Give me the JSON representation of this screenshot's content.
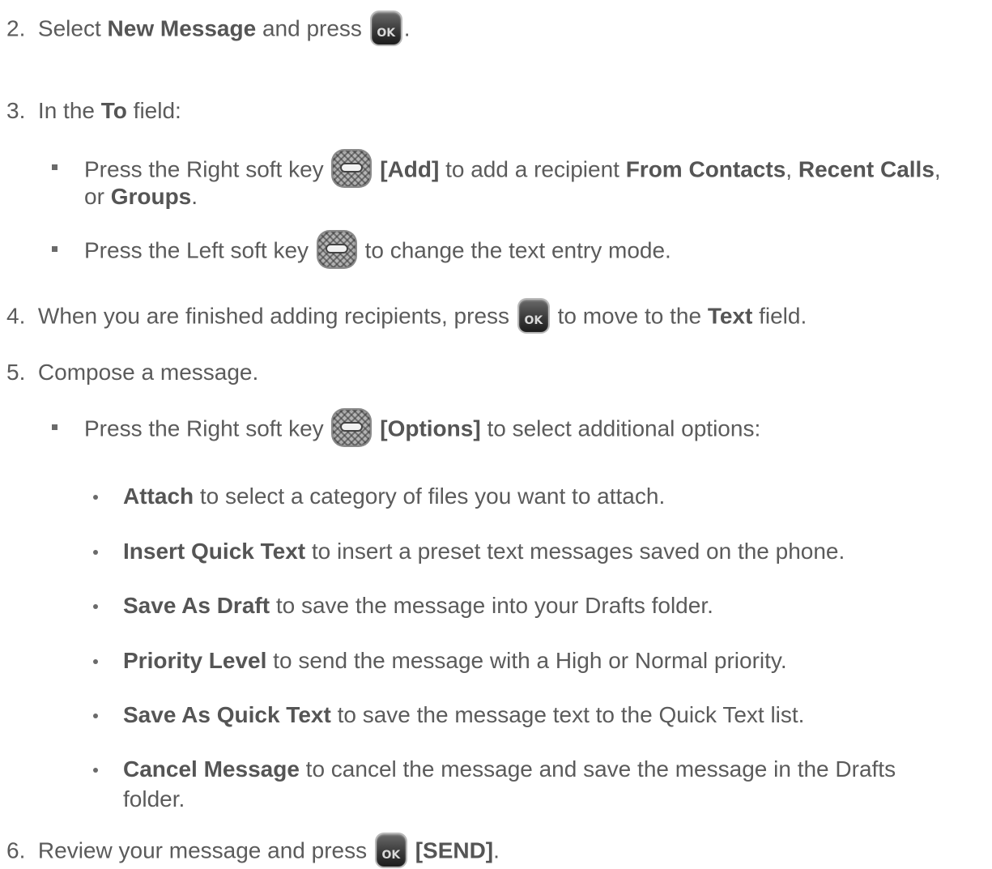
{
  "steps": {
    "s2": {
      "num": "2.",
      "a": "Select ",
      "b1": "New Message",
      "c": " and press ",
      "d": "."
    },
    "s3": {
      "num": "3.",
      "a": "In the ",
      "b1": "To",
      "c": " field:"
    },
    "s3_add": {
      "a": "Press the Right soft key ",
      "b1": "[Add]",
      "c": " to add a recipient ",
      "b2": "From Contacts",
      "d": ", ",
      "b3": "Recent Calls",
      "e": ",",
      "f": "or ",
      "b4": "Groups",
      "g": "."
    },
    "s3_left": {
      "a": "Press the Left soft key ",
      "c": " to change the text entry mode."
    },
    "s4": {
      "num": "4.",
      "a": "When you are finished adding recipients, press ",
      "c": " to move to the ",
      "b1": "Text",
      "d": " field."
    },
    "s5": {
      "num": "5.",
      "a": "Compose a message."
    },
    "s5_options": {
      "a": "Press the Right soft key ",
      "b1": "[Options]",
      "c": " to select additional options:"
    },
    "options": [
      {
        "bold": "Attach",
        "rest": " to select a category of files you want to attach."
      },
      {
        "bold": "Insert Quick Text",
        "rest": " to insert a preset text messages saved on the phone."
      },
      {
        "bold": "Save As Draft",
        "rest": " to save the message into your Drafts folder."
      },
      {
        "bold": "Priority Level",
        "rest": " to send the message with a High or Normal priority."
      },
      {
        "bold": "Save As Quick Text",
        "rest": " to save the message text to the Quick Text list."
      },
      {
        "bold": "Cancel Message",
        "rest": " to cancel the message and save the message in the Drafts",
        "rest2": "folder."
      }
    ],
    "s6": {
      "num": "6.",
      "a": "Review your message and press ",
      "b1": "[SEND]",
      "d": "."
    }
  },
  "icons": {
    "ok_key_label": "OK",
    "soft_key": "soft-key-icon",
    "ok_key": "ok-key-icon"
  }
}
